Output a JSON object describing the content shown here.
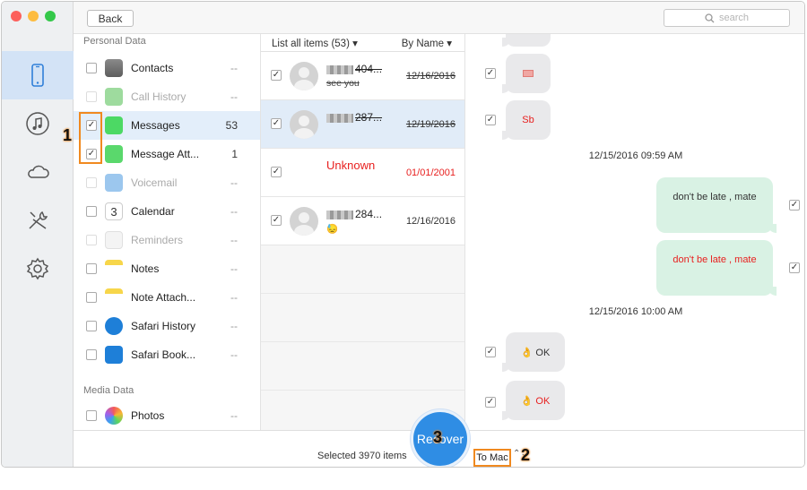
{
  "topbar": {
    "back_label": "Back",
    "search_placeholder": "search"
  },
  "sections": {
    "personal": "Personal Data",
    "media": "Media Data"
  },
  "categories": [
    {
      "label": "Contacts",
      "count": "--",
      "checked": false,
      "disabled": false,
      "icon": "contacts-icon"
    },
    {
      "label": "Call History",
      "count": "--",
      "checked": false,
      "disabled": true,
      "icon": "phone-icon"
    },
    {
      "label": "Messages",
      "count": "53",
      "checked": true,
      "disabled": false,
      "icon": "messages-icon"
    },
    {
      "label": "Message Att...",
      "count": "1",
      "checked": true,
      "disabled": false,
      "icon": "message-attachment-icon"
    },
    {
      "label": "Voicemail",
      "count": "--",
      "checked": false,
      "disabled": true,
      "icon": "voicemail-icon"
    },
    {
      "label": "Calendar",
      "count": "--",
      "checked": false,
      "disabled": false,
      "icon": "calendar-icon",
      "icon_text": "3"
    },
    {
      "label": "Reminders",
      "count": "--",
      "checked": false,
      "disabled": true,
      "icon": "reminders-icon"
    },
    {
      "label": "Notes",
      "count": "--",
      "checked": false,
      "disabled": false,
      "icon": "notes-icon"
    },
    {
      "label": "Note Attach...",
      "count": "--",
      "checked": false,
      "disabled": false,
      "icon": "note-attachment-icon"
    },
    {
      "label": "Safari History",
      "count": "--",
      "checked": false,
      "disabled": false,
      "icon": "safari-history-icon"
    },
    {
      "label": "Safari Book...",
      "count": "--",
      "checked": false,
      "disabled": false,
      "icon": "safari-bookmark-icon"
    }
  ],
  "media_categories": [
    {
      "label": "Photos",
      "count": "--",
      "checked": false,
      "icon": "photos-icon"
    }
  ],
  "list": {
    "header_left": "List all items (53)",
    "header_right": "By Name",
    "items": [
      {
        "name": "404...",
        "sub": "see you",
        "date": "12/16/2016",
        "struck": true
      },
      {
        "name": "287...",
        "sub": "",
        "date": "12/19/2016",
        "struck": true
      },
      {
        "name": "Unknown",
        "sub": "",
        "date": "01/01/2001",
        "struck": false,
        "red": true
      },
      {
        "name": "284...",
        "sub": "😓",
        "date": "12/16/2016",
        "struck": false
      }
    ]
  },
  "conversation": {
    "bubble_sb": "Sb",
    "ts1": "12/15/2016 09:59 AM",
    "out1": "don't be late , mate",
    "out2": "don't be late , mate",
    "ts2": "12/15/2016 10:00 AM",
    "ok1": "👌 OK",
    "ok2": "👌 OK"
  },
  "bottom": {
    "selected": "Selected 3970 items",
    "recover": "Recover",
    "target": "To Mac",
    "stepper": "⌃⌄"
  },
  "callouts": {
    "one": "1",
    "two": "2",
    "three": "3"
  },
  "colors": {
    "accent": "#2f8de4",
    "highlight": "#f0891f",
    "red": "#e8201f"
  }
}
